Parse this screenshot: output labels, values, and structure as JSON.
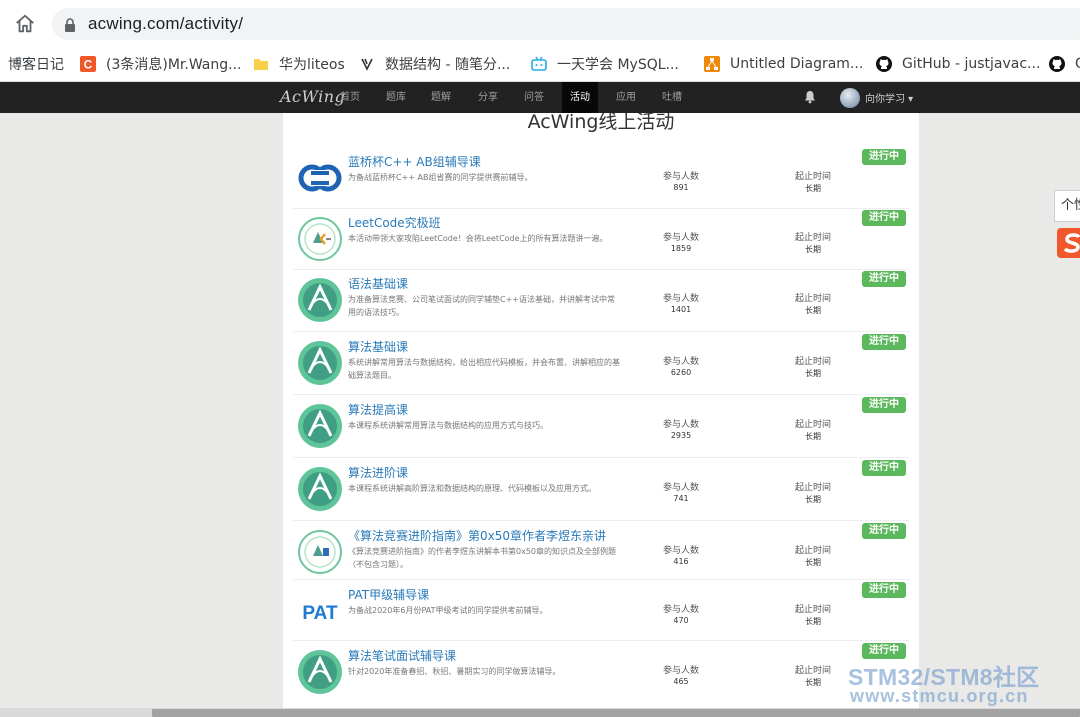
{
  "browser": {
    "url": "acwing.com/activity/",
    "bookmarks": [
      {
        "label": "博客日记",
        "icon": "none"
      },
      {
        "label": "(3条消息)Mr.Wang...",
        "icon": "csdn-icon",
        "color": "#f0582a"
      },
      {
        "label": "华为liteos",
        "icon": "folder-icon",
        "color": "#f7d14a"
      },
      {
        "label": "数据结构 - 随笔分...",
        "icon": "cnblogs-icon",
        "color": "#333333"
      },
      {
        "label": "一天学会 MySQL...",
        "icon": "bilibili-icon",
        "color": "#23ade5"
      },
      {
        "label": "Untitled Diagram...",
        "icon": "drawio-icon",
        "color": "#f08705"
      },
      {
        "label": "GitHub - justjavac...",
        "icon": "github-icon",
        "color": "#000000"
      },
      {
        "label": "G",
        "icon": "github-icon",
        "color": "#000000"
      }
    ]
  },
  "navbar": {
    "logo": "AcWing",
    "items": [
      "首页",
      "题库",
      "题解",
      "分享",
      "问答",
      "活动",
      "应用",
      "吐槽"
    ],
    "active": "活动",
    "user_name": "向你学习 ▾"
  },
  "page": {
    "heading": "AcWing线上活动"
  },
  "activities": [
    {
      "title": "蓝桥杯C++ AB组辅导课",
      "desc": "为备战蓝桥杯C++ AB组省赛的同学提供赛前辅导。",
      "participants_label": "参与人数",
      "participants": "891",
      "deadline_label": "起止时间",
      "deadline": "长期",
      "status": "进行中",
      "logo": "lanqiao"
    },
    {
      "title": "LeetCode究极班",
      "desc": "本活动带领大家攻陷LeetCode！会将LeetCode上的所有算法题讲一遍。",
      "participants_label": "参与人数",
      "participants": "1859",
      "deadline_label": "起止时间",
      "deadline": "长期",
      "status": "进行中",
      "logo": "leetcode"
    },
    {
      "title": "语法基础课",
      "desc": "为准备算法竞赛、公司笔试面试的同学辅垫C++语法基础，并讲解考试中常用的语法技巧。",
      "participants_label": "参与人数",
      "participants": "1401",
      "deadline_label": "起止时间",
      "deadline": "长期",
      "status": "进行中",
      "logo": "acwing"
    },
    {
      "title": "算法基础课",
      "desc": "系统讲解常用算法与数据结构，给出相应代码模板，并会布置、讲解相应的基础算法题目。",
      "participants_label": "参与人数",
      "participants": "6260",
      "deadline_label": "起止时间",
      "deadline": "长期",
      "status": "进行中",
      "logo": "acwing"
    },
    {
      "title": "算法提高课",
      "desc": "本课程系统讲解常用算法与数据结构的应用方式与技巧。",
      "participants_label": "参与人数",
      "participants": "2935",
      "deadline_label": "起止时间",
      "deadline": "长期",
      "status": "进行中",
      "logo": "acwing"
    },
    {
      "title": "算法进阶课",
      "desc": "本课程系统讲解高阶算法和数据结构的原理、代码模板以及应用方式。",
      "participants_label": "参与人数",
      "participants": "741",
      "deadline_label": "起止时间",
      "deadline": "长期",
      "status": "进行中",
      "logo": "acwing"
    },
    {
      "title": "《算法竞赛进阶指南》第0x50章作者李煜东亲讲",
      "desc": "《算法竞赛进阶指南》的作者李煜东讲解本书第0x50章的知识点及全部例题（不包含习题）。",
      "participants_label": "参与人数",
      "participants": "416",
      "deadline_label": "起止时间",
      "deadline": "长期",
      "status": "进行中",
      "logo": "book"
    },
    {
      "title": "PAT甲级辅导课",
      "desc": "为备战2020年6月份PAT甲级考试的同学提供考前辅导。",
      "participants_label": "参与人数",
      "participants": "470",
      "deadline_label": "起止时间",
      "deadline": "长期",
      "status": "进行中",
      "logo": "pat"
    },
    {
      "title": "算法笔试面试辅导课",
      "desc": "针对2020年准备春招、秋招、暑期实习的同学做算法辅导。",
      "participants_label": "参与人数",
      "participants": "465",
      "deadline_label": "起止时间",
      "deadline": "长期",
      "status": "进行中",
      "logo": "acwing"
    }
  ],
  "overlays": {
    "tooltip": "个性",
    "watermark_line1": "STM32/STM8社区",
    "watermark_line2": "www.stmcu.org.cn"
  }
}
